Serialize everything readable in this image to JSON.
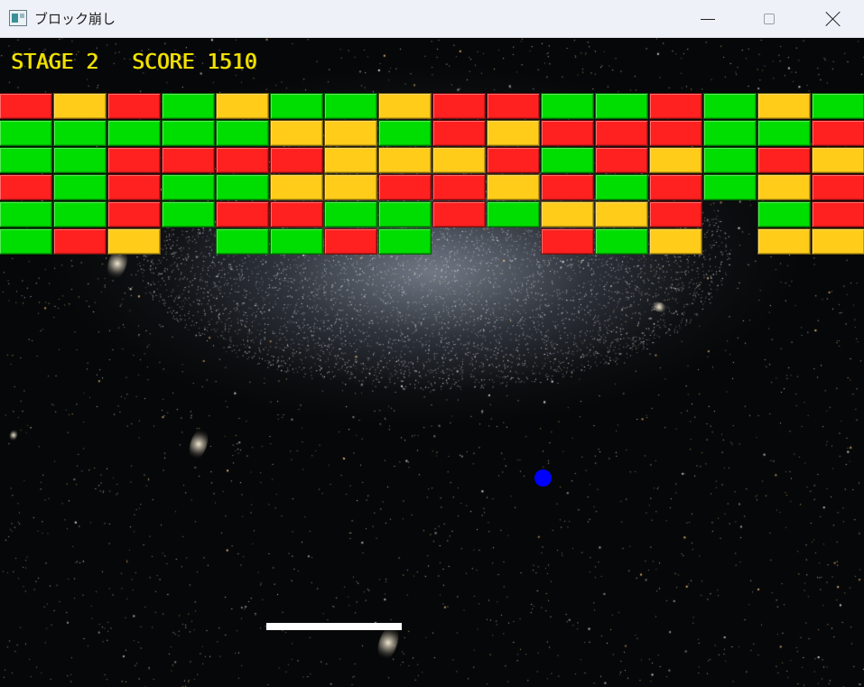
{
  "window": {
    "title": "ブロック崩し",
    "controls": [
      "minimize",
      "maximize",
      "close"
    ]
  },
  "hud": {
    "stage_text": "STAGE 2",
    "score_text": "SCORE 1510",
    "stage": 2,
    "score": 1510,
    "color": "#f5e400"
  },
  "colors": {
    "R": "#ff2020",
    "Y": "#ffcc1a",
    "G": "#00dd00",
    "ball": "#0000ff",
    "paddle": "#ffffff"
  },
  "bricks": {
    "columns": 16,
    "rows": [
      "RYRGYGGYRRGGRGYG",
      "GGGGGYYGRYRRRGGR",
      "GGRRRRYYYRGRYGRY",
      "RGRGGYYRRYRGRGYR",
      "GGRGRRGGRGYYR.GR",
      "GRY.GGRG..RGY.YY"
    ]
  },
  "ball": {
    "color": "blue"
  },
  "paddle": {
    "color": "white"
  }
}
